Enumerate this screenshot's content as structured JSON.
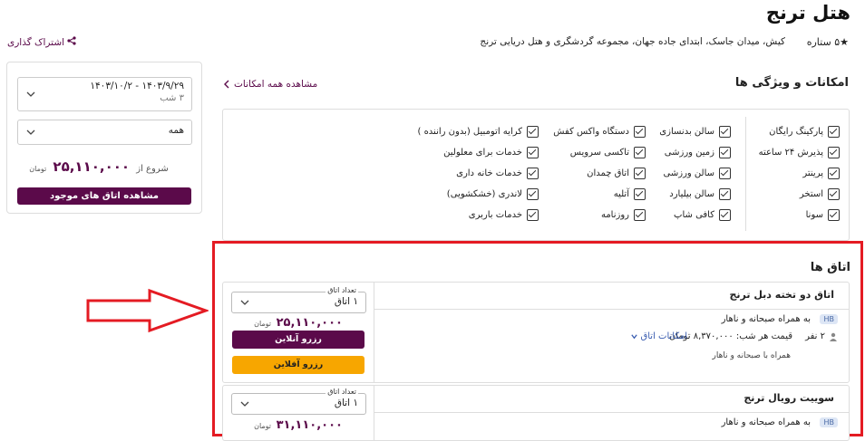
{
  "hotel": {
    "title": "هتل ترنج",
    "stars": "★۵ ستاره",
    "address": "کیش، میدان جاسک، ابتدای جاده جهان، مجموعه گردشگری و هتل دریایی ترنج",
    "share": "اشتراک گذاری"
  },
  "booking": {
    "date_range": "۱۴۰۳/۹/۲۹  -  ۱۴۰۳/۱۰/۲",
    "nights": "۳ شب",
    "guests": "همه",
    "from_label": "شروع از",
    "from_price": "۲۵,۱۱۰,۰۰۰",
    "currency": "تومان",
    "view_rooms": "مشاهده اتاق های موجود"
  },
  "amenities": {
    "title": "امکانات و ویژگی ها",
    "see_all": "مشاهده همه امکانات",
    "col1": [
      "پارکینگ رایگان",
      "پذیرش ۲۴ ساعته",
      "پرینتر",
      "استخر",
      "سونا"
    ],
    "col2": [
      "سالن بدنسازی",
      "زمین ورزشی",
      "سالن ورزشی",
      "سالن بیلیارد",
      "کافی شاپ"
    ],
    "col3": [
      "دستگاه واکس کفش",
      "تاکسی سرویس",
      "اتاق چمدان",
      "آتلیه",
      "روزنامه"
    ],
    "col4": [
      "کرایه اتومبیل (بدون راننده )",
      "خدمات برای معلولین",
      "خدمات خانه داری",
      "لاندری (خشکشویی)",
      "خدمات باربری"
    ]
  },
  "rooms": {
    "title": "اتاق ها",
    "qty_label": "تعداد اتاق",
    "qty_value": "۱ اتاق",
    "items": [
      {
        "name": "اتاق دو تخته دبل ترنج",
        "hb": "HB",
        "board": "به همراه صبحانه و ناهار",
        "people": "۲ نفر",
        "nightly": "قیمت هر شب: ۸,۳۷۰,۰۰۰ تومان",
        "amenities_link": "امکانات اتاق",
        "board_sub": "همراه با صبحانه و ناهار",
        "price": "۲۵,۱۱۰,۰۰۰",
        "currency": "تومان",
        "btn_online": "رزرو آنلاین",
        "btn_online2": "رزرو آفلاین"
      },
      {
        "name": "سوییت رویال ترنج",
        "hb": "HB",
        "board": "به همراه صبحانه و ناهار",
        "price": "۳۱,۱۱۰,۰۰۰",
        "currency": "تومان"
      }
    ]
  },
  "colors": {
    "brand": "#5b0a4a",
    "accent_orange": "#f7a600",
    "highlight_red": "#e41b23",
    "link_blue": "#3a5db0"
  },
  "icons": {
    "share": "share-icon",
    "chevron": "chevron-down-icon",
    "check": "checkbox-icon",
    "person": "person-icon",
    "arrow": "red-arrow-right"
  }
}
